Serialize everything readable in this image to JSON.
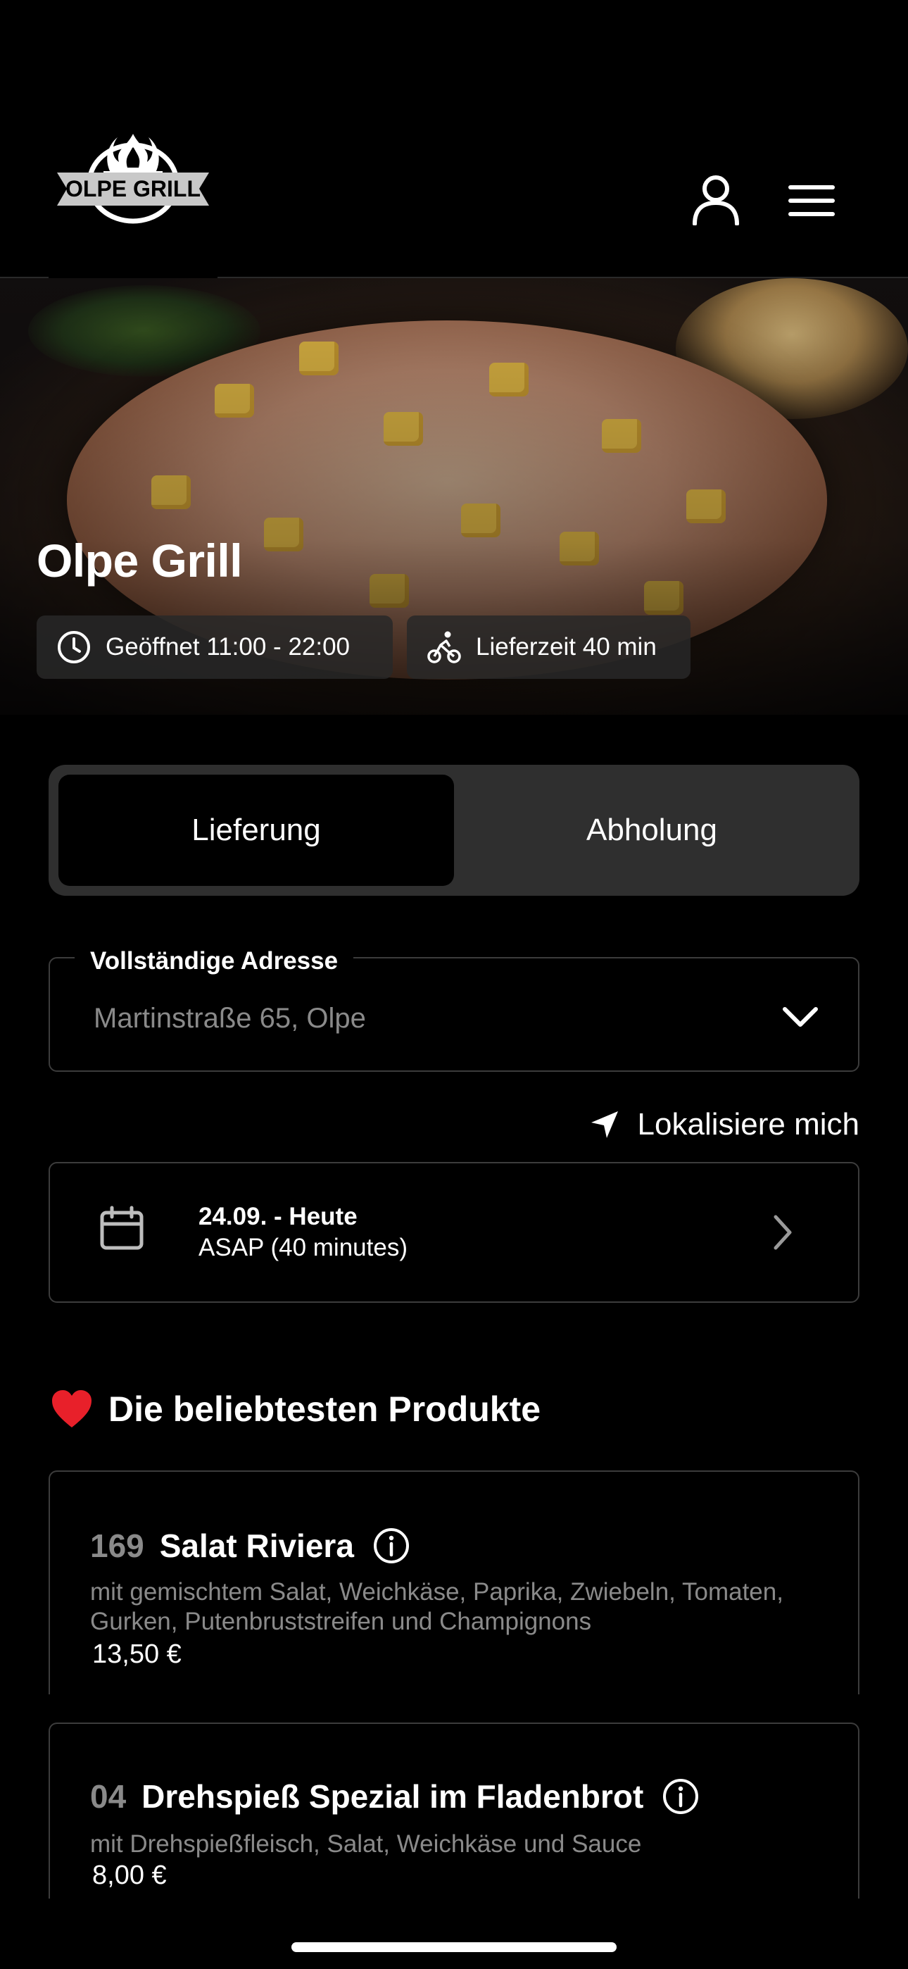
{
  "header": {
    "logo_text": "OLPE GRILL",
    "icons": [
      "user-icon",
      "menu-icon"
    ]
  },
  "hero": {
    "title": "Olpe Grill",
    "opening": "Geöffnet 11:00 - 22:00",
    "delivery_time": "Lieferzeit 40 min"
  },
  "order_mode": {
    "tabs": [
      "Lieferung",
      "Abholung"
    ],
    "selected": "Lieferung"
  },
  "address": {
    "label": "Vollständige Adresse",
    "value": "Martinstraße 65, Olpe"
  },
  "locate": {
    "label": "Lokalisiere mich"
  },
  "schedule": {
    "date": "24.09. - Heute",
    "time": "ASAP (40 minutes)"
  },
  "popular": {
    "title": "Die beliebtesten Produkte",
    "items": [
      {
        "number": "169",
        "name": "Salat Riviera",
        "description": "mit gemischtem Salat, Weichkäse, Paprika, Zwiebeln, Tomaten, Gurken, Putenbruststreifen und Champignons",
        "price": "13,50 €"
      },
      {
        "number": "04",
        "name": "Drehspieß Spezial im Fladenbrot",
        "description": "mit Drehspießfleisch, Salat, Weichkäse und Sauce",
        "price": "8,00 €"
      }
    ]
  },
  "colors": {
    "background": "#000000",
    "surface": "#2f2f2f",
    "border": "#3c3c3c",
    "muted_text": "#8a8a8a",
    "accent_heart": "#e8202a"
  }
}
